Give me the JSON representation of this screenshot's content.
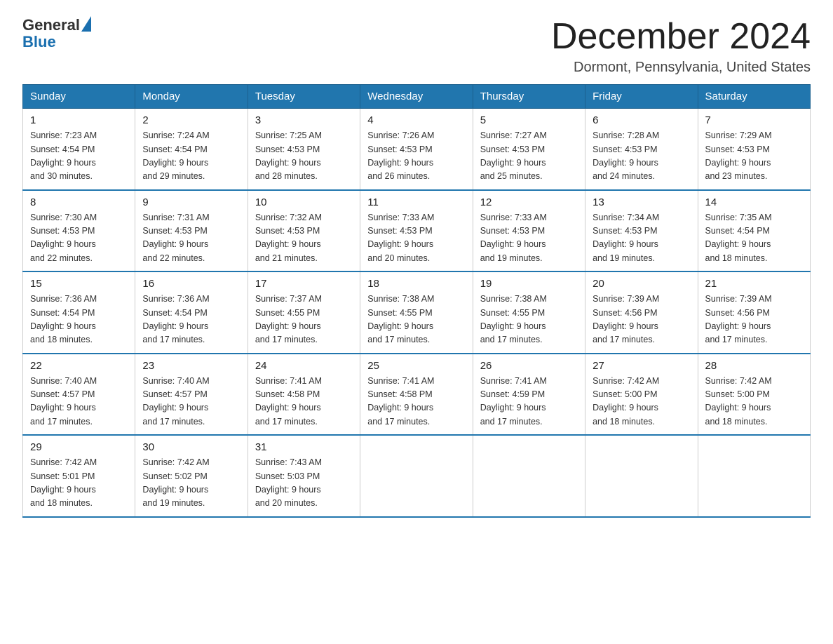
{
  "header": {
    "logo_general": "General",
    "logo_blue": "Blue",
    "month_title": "December 2024",
    "location": "Dormont, Pennsylvania, United States"
  },
  "weekdays": [
    "Sunday",
    "Monday",
    "Tuesday",
    "Wednesday",
    "Thursday",
    "Friday",
    "Saturday"
  ],
  "weeks": [
    [
      {
        "day": "1",
        "sunrise": "7:23 AM",
        "sunset": "4:54 PM",
        "daylight": "9 hours and 30 minutes."
      },
      {
        "day": "2",
        "sunrise": "7:24 AM",
        "sunset": "4:54 PM",
        "daylight": "9 hours and 29 minutes."
      },
      {
        "day": "3",
        "sunrise": "7:25 AM",
        "sunset": "4:53 PM",
        "daylight": "9 hours and 28 minutes."
      },
      {
        "day": "4",
        "sunrise": "7:26 AM",
        "sunset": "4:53 PM",
        "daylight": "9 hours and 26 minutes."
      },
      {
        "day": "5",
        "sunrise": "7:27 AM",
        "sunset": "4:53 PM",
        "daylight": "9 hours and 25 minutes."
      },
      {
        "day": "6",
        "sunrise": "7:28 AM",
        "sunset": "4:53 PM",
        "daylight": "9 hours and 24 minutes."
      },
      {
        "day": "7",
        "sunrise": "7:29 AM",
        "sunset": "4:53 PM",
        "daylight": "9 hours and 23 minutes."
      }
    ],
    [
      {
        "day": "8",
        "sunrise": "7:30 AM",
        "sunset": "4:53 PM",
        "daylight": "9 hours and 22 minutes."
      },
      {
        "day": "9",
        "sunrise": "7:31 AM",
        "sunset": "4:53 PM",
        "daylight": "9 hours and 22 minutes."
      },
      {
        "day": "10",
        "sunrise": "7:32 AM",
        "sunset": "4:53 PM",
        "daylight": "9 hours and 21 minutes."
      },
      {
        "day": "11",
        "sunrise": "7:33 AM",
        "sunset": "4:53 PM",
        "daylight": "9 hours and 20 minutes."
      },
      {
        "day": "12",
        "sunrise": "7:33 AM",
        "sunset": "4:53 PM",
        "daylight": "9 hours and 19 minutes."
      },
      {
        "day": "13",
        "sunrise": "7:34 AM",
        "sunset": "4:53 PM",
        "daylight": "9 hours and 19 minutes."
      },
      {
        "day": "14",
        "sunrise": "7:35 AM",
        "sunset": "4:54 PM",
        "daylight": "9 hours and 18 minutes."
      }
    ],
    [
      {
        "day": "15",
        "sunrise": "7:36 AM",
        "sunset": "4:54 PM",
        "daylight": "9 hours and 18 minutes."
      },
      {
        "day": "16",
        "sunrise": "7:36 AM",
        "sunset": "4:54 PM",
        "daylight": "9 hours and 17 minutes."
      },
      {
        "day": "17",
        "sunrise": "7:37 AM",
        "sunset": "4:55 PM",
        "daylight": "9 hours and 17 minutes."
      },
      {
        "day": "18",
        "sunrise": "7:38 AM",
        "sunset": "4:55 PM",
        "daylight": "9 hours and 17 minutes."
      },
      {
        "day": "19",
        "sunrise": "7:38 AM",
        "sunset": "4:55 PM",
        "daylight": "9 hours and 17 minutes."
      },
      {
        "day": "20",
        "sunrise": "7:39 AM",
        "sunset": "4:56 PM",
        "daylight": "9 hours and 17 minutes."
      },
      {
        "day": "21",
        "sunrise": "7:39 AM",
        "sunset": "4:56 PM",
        "daylight": "9 hours and 17 minutes."
      }
    ],
    [
      {
        "day": "22",
        "sunrise": "7:40 AM",
        "sunset": "4:57 PM",
        "daylight": "9 hours and 17 minutes."
      },
      {
        "day": "23",
        "sunrise": "7:40 AM",
        "sunset": "4:57 PM",
        "daylight": "9 hours and 17 minutes."
      },
      {
        "day": "24",
        "sunrise": "7:41 AM",
        "sunset": "4:58 PM",
        "daylight": "9 hours and 17 minutes."
      },
      {
        "day": "25",
        "sunrise": "7:41 AM",
        "sunset": "4:58 PM",
        "daylight": "9 hours and 17 minutes."
      },
      {
        "day": "26",
        "sunrise": "7:41 AM",
        "sunset": "4:59 PM",
        "daylight": "9 hours and 17 minutes."
      },
      {
        "day": "27",
        "sunrise": "7:42 AM",
        "sunset": "5:00 PM",
        "daylight": "9 hours and 18 minutes."
      },
      {
        "day": "28",
        "sunrise": "7:42 AM",
        "sunset": "5:00 PM",
        "daylight": "9 hours and 18 minutes."
      }
    ],
    [
      {
        "day": "29",
        "sunrise": "7:42 AM",
        "sunset": "5:01 PM",
        "daylight": "9 hours and 18 minutes."
      },
      {
        "day": "30",
        "sunrise": "7:42 AM",
        "sunset": "5:02 PM",
        "daylight": "9 hours and 19 minutes."
      },
      {
        "day": "31",
        "sunrise": "7:43 AM",
        "sunset": "5:03 PM",
        "daylight": "9 hours and 20 minutes."
      },
      null,
      null,
      null,
      null
    ]
  ],
  "labels": {
    "sunrise": "Sunrise:",
    "sunset": "Sunset:",
    "daylight": "Daylight:"
  }
}
